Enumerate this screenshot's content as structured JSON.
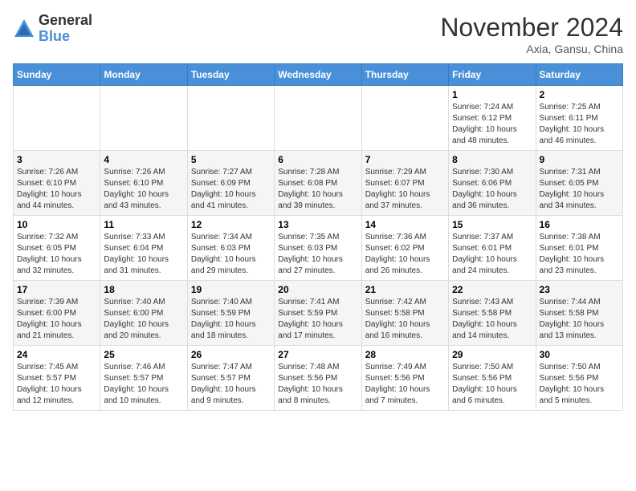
{
  "header": {
    "logo_general": "General",
    "logo_blue": "Blue",
    "month_title": "November 2024",
    "location": "Axia, Gansu, China"
  },
  "days_of_week": [
    "Sunday",
    "Monday",
    "Tuesday",
    "Wednesday",
    "Thursday",
    "Friday",
    "Saturday"
  ],
  "weeks": [
    [
      {
        "day": "",
        "info": ""
      },
      {
        "day": "",
        "info": ""
      },
      {
        "day": "",
        "info": ""
      },
      {
        "day": "",
        "info": ""
      },
      {
        "day": "",
        "info": ""
      },
      {
        "day": "1",
        "info": "Sunrise: 7:24 AM\nSunset: 6:12 PM\nDaylight: 10 hours\nand 48 minutes."
      },
      {
        "day": "2",
        "info": "Sunrise: 7:25 AM\nSunset: 6:11 PM\nDaylight: 10 hours\nand 46 minutes."
      }
    ],
    [
      {
        "day": "3",
        "info": "Sunrise: 7:26 AM\nSunset: 6:10 PM\nDaylight: 10 hours\nand 44 minutes."
      },
      {
        "day": "4",
        "info": "Sunrise: 7:26 AM\nSunset: 6:10 PM\nDaylight: 10 hours\nand 43 minutes."
      },
      {
        "day": "5",
        "info": "Sunrise: 7:27 AM\nSunset: 6:09 PM\nDaylight: 10 hours\nand 41 minutes."
      },
      {
        "day": "6",
        "info": "Sunrise: 7:28 AM\nSunset: 6:08 PM\nDaylight: 10 hours\nand 39 minutes."
      },
      {
        "day": "7",
        "info": "Sunrise: 7:29 AM\nSunset: 6:07 PM\nDaylight: 10 hours\nand 37 minutes."
      },
      {
        "day": "8",
        "info": "Sunrise: 7:30 AM\nSunset: 6:06 PM\nDaylight: 10 hours\nand 36 minutes."
      },
      {
        "day": "9",
        "info": "Sunrise: 7:31 AM\nSunset: 6:05 PM\nDaylight: 10 hours\nand 34 minutes."
      }
    ],
    [
      {
        "day": "10",
        "info": "Sunrise: 7:32 AM\nSunset: 6:05 PM\nDaylight: 10 hours\nand 32 minutes."
      },
      {
        "day": "11",
        "info": "Sunrise: 7:33 AM\nSunset: 6:04 PM\nDaylight: 10 hours\nand 31 minutes."
      },
      {
        "day": "12",
        "info": "Sunrise: 7:34 AM\nSunset: 6:03 PM\nDaylight: 10 hours\nand 29 minutes."
      },
      {
        "day": "13",
        "info": "Sunrise: 7:35 AM\nSunset: 6:03 PM\nDaylight: 10 hours\nand 27 minutes."
      },
      {
        "day": "14",
        "info": "Sunrise: 7:36 AM\nSunset: 6:02 PM\nDaylight: 10 hours\nand 26 minutes."
      },
      {
        "day": "15",
        "info": "Sunrise: 7:37 AM\nSunset: 6:01 PM\nDaylight: 10 hours\nand 24 minutes."
      },
      {
        "day": "16",
        "info": "Sunrise: 7:38 AM\nSunset: 6:01 PM\nDaylight: 10 hours\nand 23 minutes."
      }
    ],
    [
      {
        "day": "17",
        "info": "Sunrise: 7:39 AM\nSunset: 6:00 PM\nDaylight: 10 hours\nand 21 minutes."
      },
      {
        "day": "18",
        "info": "Sunrise: 7:40 AM\nSunset: 6:00 PM\nDaylight: 10 hours\nand 20 minutes."
      },
      {
        "day": "19",
        "info": "Sunrise: 7:40 AM\nSunset: 5:59 PM\nDaylight: 10 hours\nand 18 minutes."
      },
      {
        "day": "20",
        "info": "Sunrise: 7:41 AM\nSunset: 5:59 PM\nDaylight: 10 hours\nand 17 minutes."
      },
      {
        "day": "21",
        "info": "Sunrise: 7:42 AM\nSunset: 5:58 PM\nDaylight: 10 hours\nand 16 minutes."
      },
      {
        "day": "22",
        "info": "Sunrise: 7:43 AM\nSunset: 5:58 PM\nDaylight: 10 hours\nand 14 minutes."
      },
      {
        "day": "23",
        "info": "Sunrise: 7:44 AM\nSunset: 5:58 PM\nDaylight: 10 hours\nand 13 minutes."
      }
    ],
    [
      {
        "day": "24",
        "info": "Sunrise: 7:45 AM\nSunset: 5:57 PM\nDaylight: 10 hours\nand 12 minutes."
      },
      {
        "day": "25",
        "info": "Sunrise: 7:46 AM\nSunset: 5:57 PM\nDaylight: 10 hours\nand 10 minutes."
      },
      {
        "day": "26",
        "info": "Sunrise: 7:47 AM\nSunset: 5:57 PM\nDaylight: 10 hours\nand 9 minutes."
      },
      {
        "day": "27",
        "info": "Sunrise: 7:48 AM\nSunset: 5:56 PM\nDaylight: 10 hours\nand 8 minutes."
      },
      {
        "day": "28",
        "info": "Sunrise: 7:49 AM\nSunset: 5:56 PM\nDaylight: 10 hours\nand 7 minutes."
      },
      {
        "day": "29",
        "info": "Sunrise: 7:50 AM\nSunset: 5:56 PM\nDaylight: 10 hours\nand 6 minutes."
      },
      {
        "day": "30",
        "info": "Sunrise: 7:50 AM\nSunset: 5:56 PM\nDaylight: 10 hours\nand 5 minutes."
      }
    ]
  ]
}
